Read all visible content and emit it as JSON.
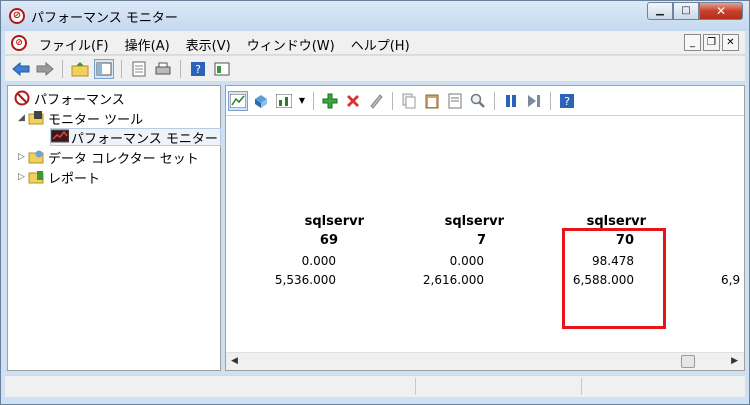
{
  "window": {
    "title": "パフォーマンス モニター"
  },
  "menu": {
    "items": [
      "ファイル(F)",
      "操作(A)",
      "表示(V)",
      "ウィンドウ(W)",
      "ヘルプ(H)"
    ]
  },
  "tree": {
    "root": "パフォーマンス",
    "monitor_tools": "モニター ツール",
    "perf_monitor": "パフォーマンス モニター",
    "data_collector_sets": "データ コレクター セット",
    "reports": "レポート"
  },
  "report": {
    "columns": [
      {
        "process": "sqlservr",
        "instance": "69",
        "value1": "0.000",
        "value2": "5,536.000"
      },
      {
        "process": "sqlservr",
        "instance": "7",
        "value1": "0.000",
        "value2": "2,616.000"
      },
      {
        "process": "sqlservr",
        "instance": "70",
        "value1": "98.478",
        "value2": "6,588.000"
      }
    ],
    "partial_value": "6,9"
  },
  "colors": {
    "highlight": "#e8141a",
    "title_bg": "#cfe0f2"
  }
}
